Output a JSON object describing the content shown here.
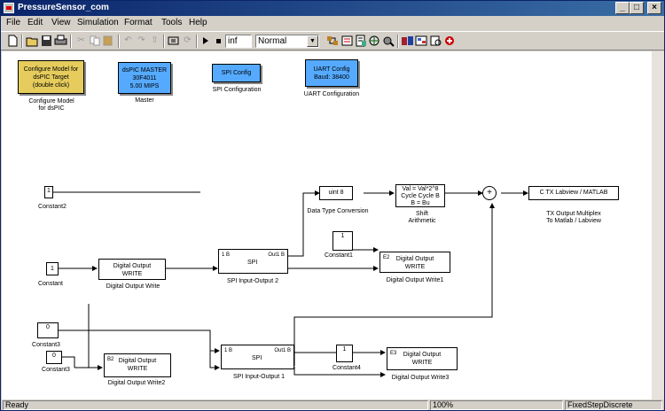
{
  "window": {
    "title": "PressureSensor_com",
    "controls": [
      "_",
      "□",
      "×"
    ]
  },
  "menu": [
    "File",
    "Edit",
    "View",
    "Simulation",
    "Format",
    "Tools",
    "Help"
  ],
  "toolbar": {
    "stop_time": "inf",
    "sim_mode": "Normal"
  },
  "config_blocks": [
    {
      "text": [
        "Configure Model for",
        "dsPIC Target",
        "(double click)"
      ],
      "label": [
        "Configure Model",
        "for dsPIC"
      ],
      "color": "#e5cc5c"
    },
    {
      "text": [
        "dsPIC MASTER",
        "30F4011",
        "5.00 MIPS"
      ],
      "label": [
        "Master"
      ],
      "color": "#55aaff"
    },
    {
      "text": [
        "SPI Config"
      ],
      "label": [
        "SPI Configuration"
      ],
      "color": "#55aaff"
    },
    {
      "text": [
        "UART Config",
        "Baud: 38400"
      ],
      "label": [
        "UART Configuration"
      ],
      "color": "#55aaff"
    }
  ],
  "blocks": {
    "const_top": {
      "value": "1",
      "label": "Constant2"
    },
    "const1": {
      "value": "1",
      "label": "Constant"
    },
    "dout1": {
      "title": "Digital Output",
      "sub": "WRITE",
      "label": "Digital Output Write"
    },
    "spi1": {
      "ports_in": [
        "1 B",
        ""
      ],
      "center": "SPI",
      "port_out": "Out1 B",
      "label": "SPI Input-Output 2"
    },
    "uint": {
      "text": "uint 8",
      "label": "Data Type Conversion"
    },
    "shift": {
      "text": [
        "Val = Val*2^8",
        "Cycle Cycle B",
        "B = Bu"
      ],
      "label": [
        "Shift",
        "Arithmetic"
      ]
    },
    "sum": {
      "text": "+"
    },
    "tx": {
      "text": "C TX  Labview / MATLAB",
      "label": [
        "TX Output      Multiplex",
        "To Matlab / Labview"
      ]
    },
    "const_mid": {
      "value": "1",
      "label": "Constant1"
    },
    "dout2": {
      "title": "Digital Output",
      "sub": "WRITE",
      "port": "E2",
      "label": "Digital Output Write1"
    },
    "const3a": {
      "value": "0",
      "label": "Constant3"
    },
    "const3": {
      "value": "0",
      "label": "Constant3"
    },
    "dout3": {
      "title": "Digital Output",
      "sub": "WRITE",
      "port": "B2",
      "label": "Digital Output Write2"
    },
    "spi2": {
      "ports_in": [
        "1 B",
        ""
      ],
      "center": "SPI",
      "port_out": "Out1 B",
      "label": "SPI Input-Output 1"
    },
    "const4": {
      "value": "1",
      "label": "Constant4"
    },
    "dout4": {
      "title": "Digital Output",
      "sub": "WRITE",
      "port": "E3",
      "label": "Digital Output Write3"
    }
  },
  "status": {
    "state": "Ready",
    "zoom": "100%",
    "solver": "FixedStepDiscrete"
  }
}
